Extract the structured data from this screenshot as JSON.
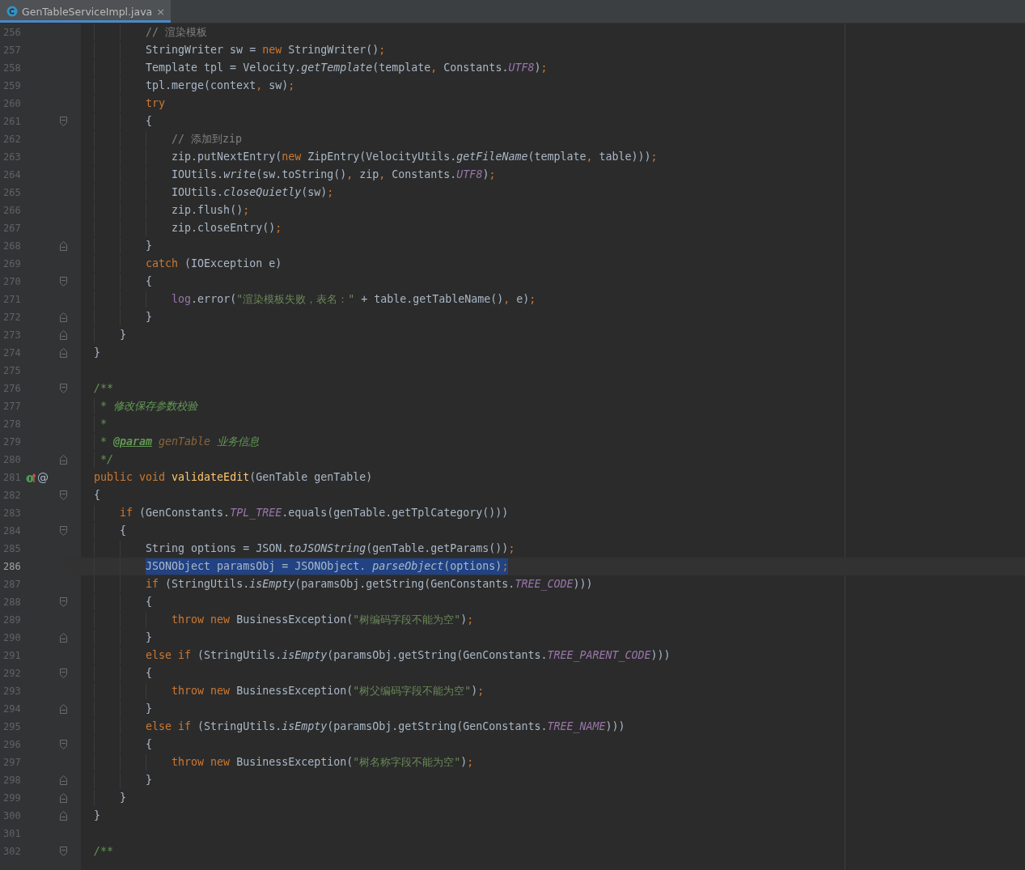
{
  "tab": {
    "title": "GenTableServiceImpl.java",
    "selected": true,
    "close": "×"
  },
  "lines": [
    {
      "number": "256",
      "text_selected": false,
      "current": false,
      "tokens": [
        {
          "kind": "comment",
          "text": "        // 渲染模板"
        }
      ]
    },
    {
      "number": "257",
      "text_selected": false,
      "current": false,
      "tokens": [
        {
          "kind": "plain",
          "text": "        StringWriter sw = "
        },
        {
          "kind": "kw",
          "text": "new"
        },
        {
          "kind": "plain",
          "text": " StringWriter()"
        },
        {
          "kind": "punct",
          "text": ";"
        }
      ]
    },
    {
      "number": "258",
      "text_selected": false,
      "current": false,
      "tokens": [
        {
          "kind": "plain",
          "text": "        Template tpl = Velocity."
        },
        {
          "kind": "static",
          "text": "getTemplate"
        },
        {
          "kind": "plain",
          "text": "(template"
        },
        {
          "kind": "punct",
          "text": ","
        },
        {
          "kind": "plain",
          "text": " Constants."
        },
        {
          "kind": "const",
          "text": "UTF8"
        },
        {
          "kind": "plain",
          "text": ")"
        },
        {
          "kind": "punct",
          "text": ";"
        }
      ]
    },
    {
      "number": "259",
      "text_selected": false,
      "current": false,
      "tokens": [
        {
          "kind": "plain",
          "text": "        tpl.merge(context"
        },
        {
          "kind": "punct",
          "text": ","
        },
        {
          "kind": "plain",
          "text": " sw)"
        },
        {
          "kind": "punct",
          "text": ";"
        }
      ]
    },
    {
      "number": "260",
      "text_selected": false,
      "current": false,
      "tokens": [
        {
          "kind": "kw",
          "text": "        try"
        }
      ]
    },
    {
      "number": "261",
      "fold": {
        "kind": "start"
      },
      "text_selected": false,
      "current": false,
      "tokens": [
        {
          "kind": "plain",
          "text": "        {"
        }
      ]
    },
    {
      "number": "262",
      "text_selected": false,
      "current": false,
      "tokens": [
        {
          "kind": "comment",
          "text": "            // 添加到zip"
        }
      ]
    },
    {
      "number": "263",
      "text_selected": false,
      "current": false,
      "tokens": [
        {
          "kind": "plain",
          "text": "            zip.putNextEntry("
        },
        {
          "kind": "kw",
          "text": "new"
        },
        {
          "kind": "plain",
          "text": " ZipEntry(VelocityUtils."
        },
        {
          "kind": "static",
          "text": "getFileName"
        },
        {
          "kind": "plain",
          "text": "(template"
        },
        {
          "kind": "punct",
          "text": ","
        },
        {
          "kind": "plain",
          "text": " table)))"
        },
        {
          "kind": "punct",
          "text": ";"
        }
      ]
    },
    {
      "number": "264",
      "text_selected": false,
      "current": false,
      "tokens": [
        {
          "kind": "plain",
          "text": "            IOUtils."
        },
        {
          "kind": "static",
          "text": "write"
        },
        {
          "kind": "plain",
          "text": "(sw.toString()"
        },
        {
          "kind": "punct",
          "text": ","
        },
        {
          "kind": "plain",
          "text": " zip"
        },
        {
          "kind": "punct",
          "text": ","
        },
        {
          "kind": "plain",
          "text": " Constants."
        },
        {
          "kind": "const",
          "text": "UTF8"
        },
        {
          "kind": "plain",
          "text": ")"
        },
        {
          "kind": "punct",
          "text": ";"
        }
      ]
    },
    {
      "number": "265",
      "text_selected": false,
      "current": false,
      "tokens": [
        {
          "kind": "plain",
          "text": "            IOUtils."
        },
        {
          "kind": "static",
          "text": "closeQuietly"
        },
        {
          "kind": "plain",
          "text": "(sw)"
        },
        {
          "kind": "punct",
          "text": ";"
        }
      ]
    },
    {
      "number": "266",
      "text_selected": false,
      "current": false,
      "tokens": [
        {
          "kind": "plain",
          "text": "            zip.flush()"
        },
        {
          "kind": "punct",
          "text": ";"
        }
      ]
    },
    {
      "number": "267",
      "text_selected": false,
      "current": false,
      "tokens": [
        {
          "kind": "plain",
          "text": "            zip.closeEntry()"
        },
        {
          "kind": "punct",
          "text": ";"
        }
      ]
    },
    {
      "number": "268",
      "fold": {
        "kind": "end"
      },
      "text_selected": false,
      "current": false,
      "tokens": [
        {
          "kind": "plain",
          "text": "        }"
        }
      ]
    },
    {
      "number": "269",
      "text_selected": false,
      "current": false,
      "tokens": [
        {
          "kind": "kw",
          "text": "        catch"
        },
        {
          "kind": "plain",
          "text": " (IOException e)"
        }
      ]
    },
    {
      "number": "270",
      "fold": {
        "kind": "start"
      },
      "text_selected": false,
      "current": false,
      "tokens": [
        {
          "kind": "plain",
          "text": "        {"
        }
      ]
    },
    {
      "number": "271",
      "text_selected": false,
      "current": false,
      "tokens": [
        {
          "kind": "field",
          "text": "            log"
        },
        {
          "kind": "plain",
          "text": ".error("
        },
        {
          "kind": "str",
          "text": "\"渲染模板失败，表名：\""
        },
        {
          "kind": "plain",
          "text": " + table.getTableName()"
        },
        {
          "kind": "punct",
          "text": ","
        },
        {
          "kind": "plain",
          "text": " e)"
        },
        {
          "kind": "punct",
          "text": ";"
        }
      ]
    },
    {
      "number": "272",
      "fold": {
        "kind": "end"
      },
      "text_selected": false,
      "current": false,
      "tokens": [
        {
          "kind": "plain",
          "text": "        }"
        }
      ]
    },
    {
      "number": "273",
      "fold": {
        "kind": "end"
      },
      "text_selected": false,
      "current": false,
      "tokens": [
        {
          "kind": "plain",
          "text": "    }"
        }
      ]
    },
    {
      "number": "274",
      "fold": {
        "kind": "end"
      },
      "text_selected": false,
      "current": false,
      "tokens": [
        {
          "kind": "plain",
          "text": "}"
        }
      ]
    },
    {
      "number": "275",
      "text_selected": false,
      "current": false
    },
    {
      "number": "276",
      "fold": {
        "kind": "start"
      },
      "text_selected": false,
      "current": false,
      "tokens": [
        {
          "kind": "doc",
          "text": "/**"
        }
      ]
    },
    {
      "number": "277",
      "text_selected": false,
      "current": false,
      "tokens": [
        {
          "kind": "doc",
          "text": " * 修改保存参数校验"
        }
      ]
    },
    {
      "number": "278",
      "text_selected": false,
      "current": false,
      "tokens": [
        {
          "kind": "doc",
          "text": " *"
        }
      ]
    },
    {
      "number": "279",
      "text_selected": false,
      "current": false,
      "tokens": [
        {
          "kind": "doc",
          "text": " * "
        },
        {
          "kind": "doctag",
          "text": "@param"
        },
        {
          "kind": "docparam",
          "text": " genTable"
        },
        {
          "kind": "doc",
          "text": " 业务信息"
        }
      ]
    },
    {
      "number": "280",
      "fold": {
        "kind": "end"
      },
      "text_selected": false,
      "current": false,
      "tokens": [
        {
          "kind": "doc",
          "text": " */"
        }
      ]
    },
    {
      "number": "281",
      "gutter_icon": {
        "kind": "implements"
      },
      "gutter_text": "@",
      "text_selected": false,
      "current": false,
      "tokens": [
        {
          "kind": "kw",
          "text": "public void "
        },
        {
          "kind": "fn",
          "text": "validateEdit"
        },
        {
          "kind": "plain",
          "text": "(GenTable genTable)"
        }
      ]
    },
    {
      "number": "282",
      "fold": {
        "kind": "start"
      },
      "text_selected": false,
      "current": false,
      "tokens": [
        {
          "kind": "plain",
          "text": "{"
        }
      ]
    },
    {
      "number": "283",
      "text_selected": false,
      "current": false,
      "tokens": [
        {
          "kind": "kw",
          "text": "    if"
        },
        {
          "kind": "plain",
          "text": " (GenConstants."
        },
        {
          "kind": "const",
          "text": "TPL_TREE"
        },
        {
          "kind": "plain",
          "text": ".equals(genTable.getTplCategory()))"
        }
      ]
    },
    {
      "number": "284",
      "fold": {
        "kind": "start"
      },
      "text_selected": false,
      "current": false,
      "tokens": [
        {
          "kind": "plain",
          "text": "    {"
        }
      ]
    },
    {
      "number": "285",
      "text_selected": false,
      "current": false,
      "tokens": [
        {
          "kind": "plain",
          "text": "        String options = JSON."
        },
        {
          "kind": "static",
          "text": "toJSONString"
        },
        {
          "kind": "plain",
          "text": "(genTable.getParams())"
        },
        {
          "kind": "punct",
          "text": ";"
        }
      ]
    },
    {
      "number": "286",
      "text_selected": true,
      "current": true,
      "tokens": [
        {
          "kind": "plain",
          "text": "        JSONObject paramsObj = JSONObject. "
        },
        {
          "kind": "static",
          "text": "parseObject"
        },
        {
          "kind": "plain",
          "text": "(options)"
        },
        {
          "kind": "punct",
          "text": ";"
        }
      ]
    },
    {
      "number": "287",
      "text_selected": false,
      "current": false,
      "tokens": [
        {
          "kind": "kw",
          "text": "        if"
        },
        {
          "kind": "plain",
          "text": " (StringUtils."
        },
        {
          "kind": "static",
          "text": "isEmpty"
        },
        {
          "kind": "plain",
          "text": "(paramsObj.getString(GenConstants."
        },
        {
          "kind": "const",
          "text": "TREE_CODE"
        },
        {
          "kind": "plain",
          "text": ")))"
        }
      ]
    },
    {
      "number": "288",
      "fold": {
        "kind": "start"
      },
      "text_selected": false,
      "current": false,
      "tokens": [
        {
          "kind": "plain",
          "text": "        {"
        }
      ]
    },
    {
      "number": "289",
      "text_selected": false,
      "current": false,
      "tokens": [
        {
          "kind": "kw",
          "text": "            throw new"
        },
        {
          "kind": "plain",
          "text": " BusinessException("
        },
        {
          "kind": "str",
          "text": "\"树编码字段不能为空\""
        },
        {
          "kind": "plain",
          "text": ")"
        },
        {
          "kind": "punct",
          "text": ";"
        }
      ]
    },
    {
      "number": "290",
      "fold": {
        "kind": "end"
      },
      "text_selected": false,
      "current": false,
      "tokens": [
        {
          "kind": "plain",
          "text": "        }"
        }
      ]
    },
    {
      "number": "291",
      "text_selected": false,
      "current": false,
      "tokens": [
        {
          "kind": "kw",
          "text": "        else if"
        },
        {
          "kind": "plain",
          "text": " (StringUtils."
        },
        {
          "kind": "static",
          "text": "isEmpty"
        },
        {
          "kind": "plain",
          "text": "(paramsObj.getString(GenConstants."
        },
        {
          "kind": "const",
          "text": "TREE_PARENT_CODE"
        },
        {
          "kind": "plain",
          "text": ")))"
        }
      ]
    },
    {
      "number": "292",
      "fold": {
        "kind": "start"
      },
      "text_selected": false,
      "current": false,
      "tokens": [
        {
          "kind": "plain",
          "text": "        {"
        }
      ]
    },
    {
      "number": "293",
      "text_selected": false,
      "current": false,
      "tokens": [
        {
          "kind": "kw",
          "text": "            throw new"
        },
        {
          "kind": "plain",
          "text": " BusinessException("
        },
        {
          "kind": "str",
          "text": "\"树父编码字段不能为空\""
        },
        {
          "kind": "plain",
          "text": ")"
        },
        {
          "kind": "punct",
          "text": ";"
        }
      ]
    },
    {
      "number": "294",
      "fold": {
        "kind": "end"
      },
      "text_selected": false,
      "current": false,
      "tokens": [
        {
          "kind": "plain",
          "text": "        }"
        }
      ]
    },
    {
      "number": "295",
      "text_selected": false,
      "current": false,
      "tokens": [
        {
          "kind": "kw",
          "text": "        else if"
        },
        {
          "kind": "plain",
          "text": " (StringUtils."
        },
        {
          "kind": "static",
          "text": "isEmpty"
        },
        {
          "kind": "plain",
          "text": "(paramsObj.getString(GenConstants."
        },
        {
          "kind": "const",
          "text": "TREE_NAME"
        },
        {
          "kind": "plain",
          "text": ")))"
        }
      ]
    },
    {
      "number": "296",
      "fold": {
        "kind": "start"
      },
      "text_selected": false,
      "current": false,
      "tokens": [
        {
          "kind": "plain",
          "text": "        {"
        }
      ]
    },
    {
      "number": "297",
      "text_selected": false,
      "current": false,
      "tokens": [
        {
          "kind": "kw",
          "text": "            throw new"
        },
        {
          "kind": "plain",
          "text": " BusinessException("
        },
        {
          "kind": "str",
          "text": "\"树名称字段不能为空\""
        },
        {
          "kind": "plain",
          "text": ")"
        },
        {
          "kind": "punct",
          "text": ";"
        }
      ]
    },
    {
      "number": "298",
      "fold": {
        "kind": "end"
      },
      "text_selected": false,
      "current": false,
      "tokens": [
        {
          "kind": "plain",
          "text": "        }"
        }
      ]
    },
    {
      "number": "299",
      "fold": {
        "kind": "end"
      },
      "text_selected": false,
      "current": false,
      "tokens": [
        {
          "kind": "plain",
          "text": "    }"
        }
      ]
    },
    {
      "number": "300",
      "fold": {
        "kind": "end"
      },
      "text_selected": false,
      "current": false,
      "tokens": [
        {
          "kind": "plain",
          "text": "}"
        }
      ]
    },
    {
      "number": "301",
      "text_selected": false,
      "current": false
    },
    {
      "number": "302",
      "fold": {
        "kind": "start"
      },
      "text_selected": false,
      "current": false,
      "tokens": [
        {
          "kind": "doc",
          "text": "/**"
        }
      ]
    }
  ]
}
